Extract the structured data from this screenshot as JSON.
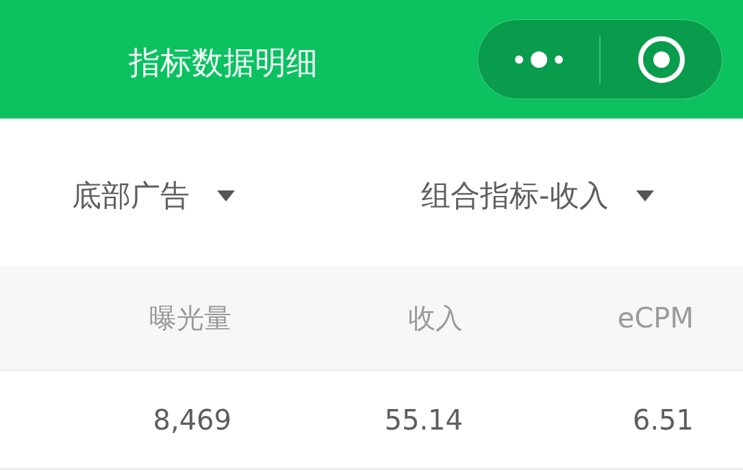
{
  "header": {
    "title": "指标数据明细"
  },
  "filters": [
    {
      "label": "底部广告"
    },
    {
      "label": "组合指标-收入"
    }
  ],
  "table": {
    "columns": [
      "曝光量",
      "收入",
      "eCPM"
    ],
    "rows": [
      [
        "8,469",
        "55.14",
        "6.51"
      ]
    ]
  }
}
